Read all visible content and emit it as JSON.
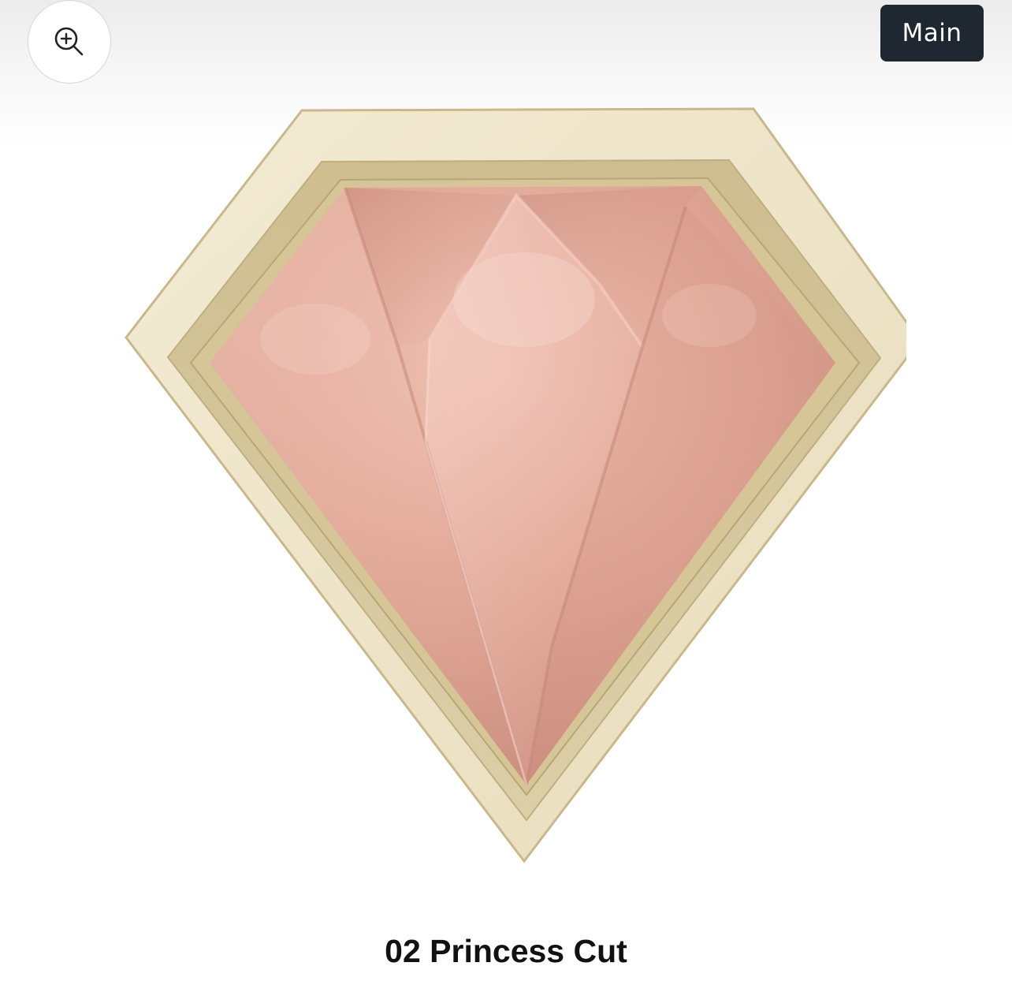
{
  "toolbar": {
    "zoom_icon": "zoom-in-icon",
    "badge_label": "Main"
  },
  "product": {
    "shade_label": "02 Princess Cut"
  },
  "colors": {
    "badge_bg": "#1f2730",
    "case_cream": "#efe6cc",
    "case_inner": "#d9cba0",
    "powder_pink": "#e3a999"
  }
}
